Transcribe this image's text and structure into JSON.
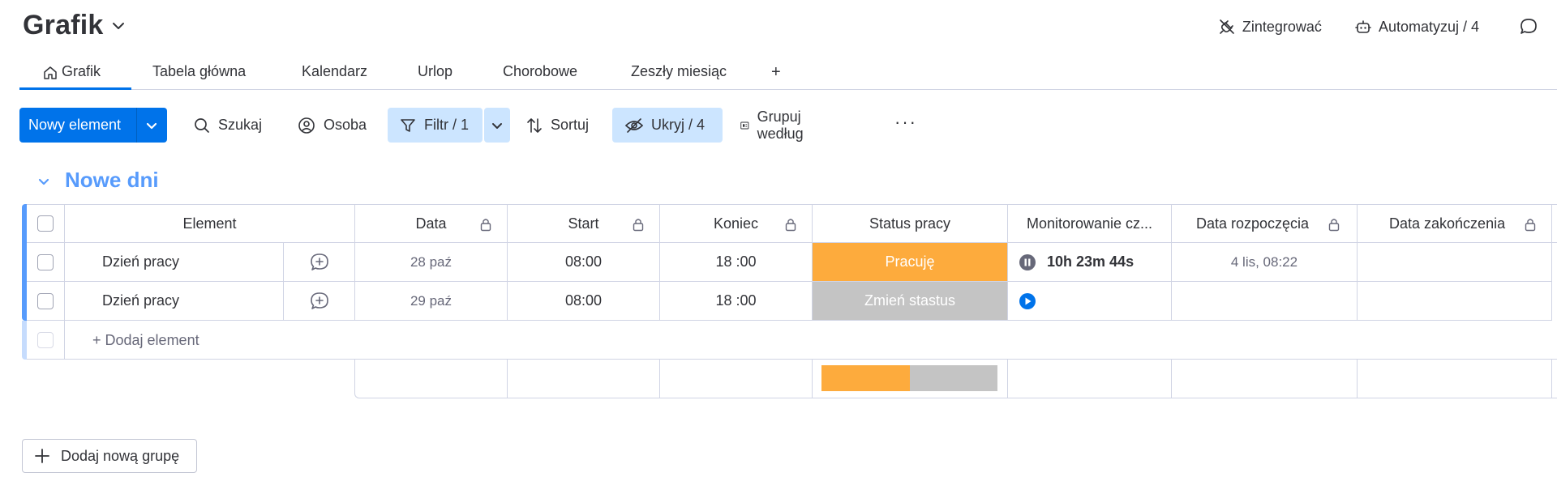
{
  "header": {
    "title": "Grafik",
    "integrate_label": "Zintegrować",
    "automate_label": "Automatyzuj / 4"
  },
  "tabs": [
    {
      "label": "Grafik",
      "active": true,
      "icon": "home-icon"
    },
    {
      "label": "Tabela główna"
    },
    {
      "label": "Kalendarz"
    },
    {
      "label": "Urlop"
    },
    {
      "label": "Chorobowe"
    },
    {
      "label": "Zeszły miesiąc"
    },
    {
      "label": "+"
    }
  ],
  "toolbar": {
    "new_item": "Nowy element",
    "search": "Szukaj",
    "person": "Osoba",
    "filter": "Filtr / 1",
    "sort": "Sortuj",
    "hide": "Ukryj / 4",
    "group_by": "Grupuj według",
    "more": "···"
  },
  "group": {
    "title": "Nowe dni",
    "color": "#579bfc"
  },
  "table": {
    "columns": [
      {
        "label": "Element"
      },
      {
        "label": "Data",
        "locked": true
      },
      {
        "label": "Start",
        "locked": true
      },
      {
        "label": "Koniec",
        "locked": true
      },
      {
        "label": "Status pracy"
      },
      {
        "label": "Monitorowanie cz..."
      },
      {
        "label": "Data rozpoczęcia",
        "locked": true
      },
      {
        "label": "Data zakończenia",
        "locked": true
      }
    ],
    "rows": [
      {
        "name": "Dzień pracy",
        "date": "28 paź",
        "start": "08:00",
        "end": "18 :00",
        "status": "Pracuję",
        "status_color": "#fdab3d",
        "timer_state": "paused",
        "timer": "10h 23m 44s",
        "start_date": "4 lis, 08:22",
        "end_date": ""
      },
      {
        "name": "Dzień pracy",
        "date": "29 paź",
        "start": "08:00",
        "end": "18 :00",
        "status": "Zmień stastus",
        "status_color": "#c4c4c4",
        "timer_state": "play",
        "timer": "",
        "start_date": "",
        "end_date": ""
      }
    ],
    "add_item": "+ Dodaj element",
    "status_summary": [
      {
        "color": "#fdab3d",
        "fraction": 0.5
      },
      {
        "color": "#c4c4c4",
        "fraction": 0.5
      }
    ]
  },
  "add_group": "Dodaj nową grupę",
  "colors": {
    "primary": "#0073ea",
    "highlight": "#cce5ff",
    "group": "#579bfc"
  }
}
